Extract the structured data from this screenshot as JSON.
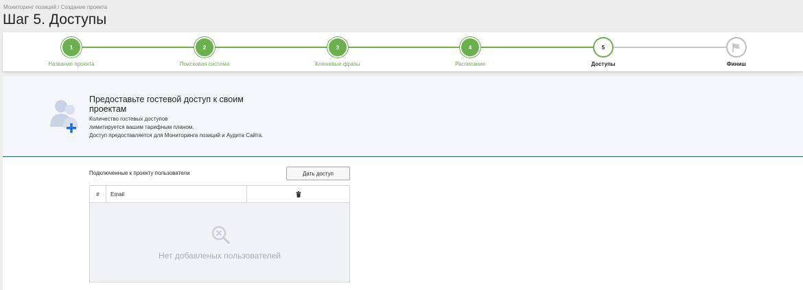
{
  "breadcrumb": "Мониторинг позиций / Создание проекта",
  "page_title": "Шаг 5. Доступы",
  "steps": [
    {
      "number": "1",
      "label": "Название проекта",
      "state": "done"
    },
    {
      "number": "2",
      "label": "Поисковая система",
      "state": "done"
    },
    {
      "number": "3",
      "label": "Ключевые фразы",
      "state": "done"
    },
    {
      "number": "4",
      "label": "Расписание",
      "state": "done"
    },
    {
      "number": "5",
      "label": "Доступы",
      "state": "active"
    },
    {
      "number": "",
      "label": "Финиш",
      "state": "pending",
      "icon": "flag-icon"
    }
  ],
  "banner": {
    "icon": "add-users-icon",
    "title": "Предоставьте гостевой доступ к своим проектам",
    "line1": "Количество гостевых доступов",
    "line2": "лимитируется вашим тарифным планом.",
    "line3": "Доступ предоставляется для Мониторинга позиций и Аудита Сайта."
  },
  "users": {
    "label": "Подключенные к проекту пользователи",
    "give_access_button": "Дать доступ",
    "columns": {
      "num": "#",
      "email": "Email",
      "delete_icon": "trash-icon"
    },
    "rows": [],
    "empty_icon": "search-x-icon",
    "empty_text": "Нет добавленых пользователей"
  },
  "colors": {
    "accent_green": "#6ab04c",
    "divider_teal": "#1e6b6b",
    "icon_blue": "#1f6fd1"
  }
}
